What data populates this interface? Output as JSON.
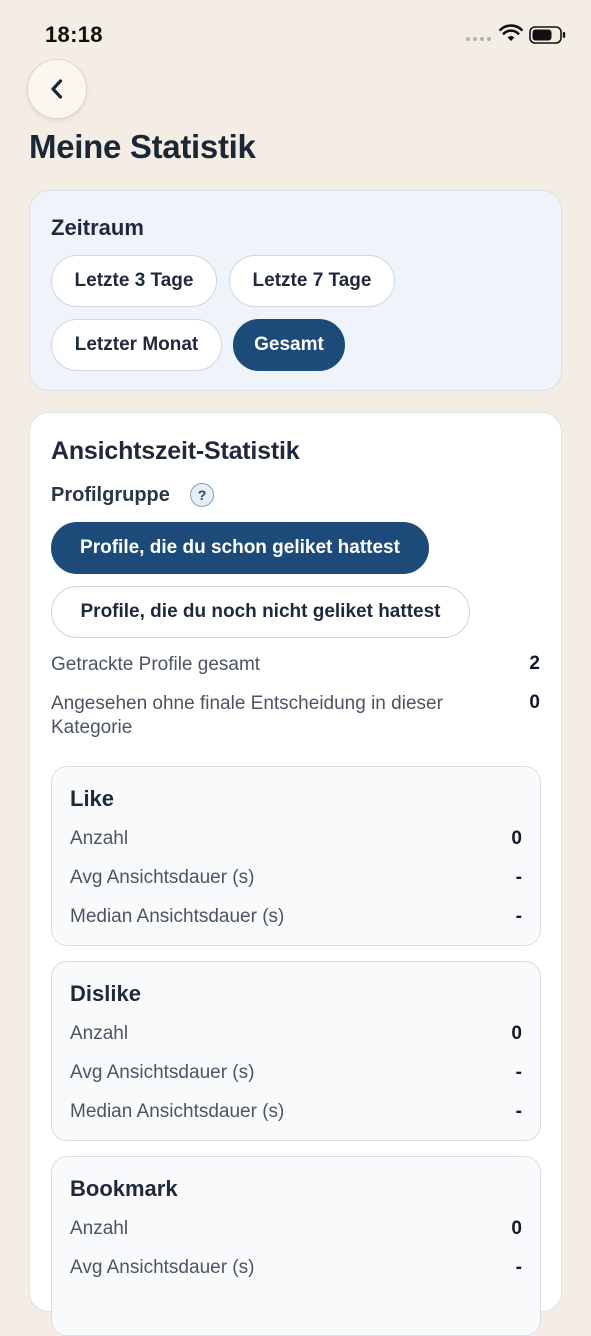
{
  "status_bar": {
    "time": "18:18"
  },
  "page": {
    "title": "Meine Statistik"
  },
  "zeitraum": {
    "title": "Zeitraum",
    "options": [
      "Letzte 3 Tage",
      "Letzte 7 Tage",
      "Letzter Monat",
      "Gesamt"
    ],
    "selected": "Gesamt"
  },
  "stats": {
    "title": "Ansichtszeit-Statistik",
    "group_label": "Profilgruppe",
    "help_symbol": "?",
    "groups": [
      "Profile, die du schon geliket hattest",
      "Profile, die du noch nicht geliket hattest"
    ],
    "selected_group": "Profile, die du schon geliket hattest",
    "summary": [
      {
        "label": "Getrackte Profile gesamt",
        "value": "2"
      },
      {
        "label": "Angesehen ohne finale Entscheidung in dieser Kategorie",
        "value": "0"
      }
    ],
    "categories": [
      {
        "title": "Like",
        "rows": [
          {
            "label": "Anzahl",
            "value": "0"
          },
          {
            "label": "Avg Ansichtsdauer (s)",
            "value": "-"
          },
          {
            "label": "Median Ansichtsdauer (s)",
            "value": "-"
          }
        ]
      },
      {
        "title": "Dislike",
        "rows": [
          {
            "label": "Anzahl",
            "value": "0"
          },
          {
            "label": "Avg Ansichtsdauer (s)",
            "value": "-"
          },
          {
            "label": "Median Ansichtsdauer (s)",
            "value": "-"
          }
        ]
      },
      {
        "title": "Bookmark",
        "rows": [
          {
            "label": "Anzahl",
            "value": "0"
          },
          {
            "label": "Avg Ansichtsdauer (s)",
            "value": "-"
          }
        ]
      }
    ]
  },
  "colors": {
    "background": "#f3ede3",
    "accent": "#1d4b79",
    "card": "#ffffff",
    "card_tinted": "#eff4fb"
  },
  "icons": {
    "back": "chevron-left-icon",
    "wifi": "wifi-icon",
    "battery": "battery-icon",
    "help": "help-icon"
  }
}
